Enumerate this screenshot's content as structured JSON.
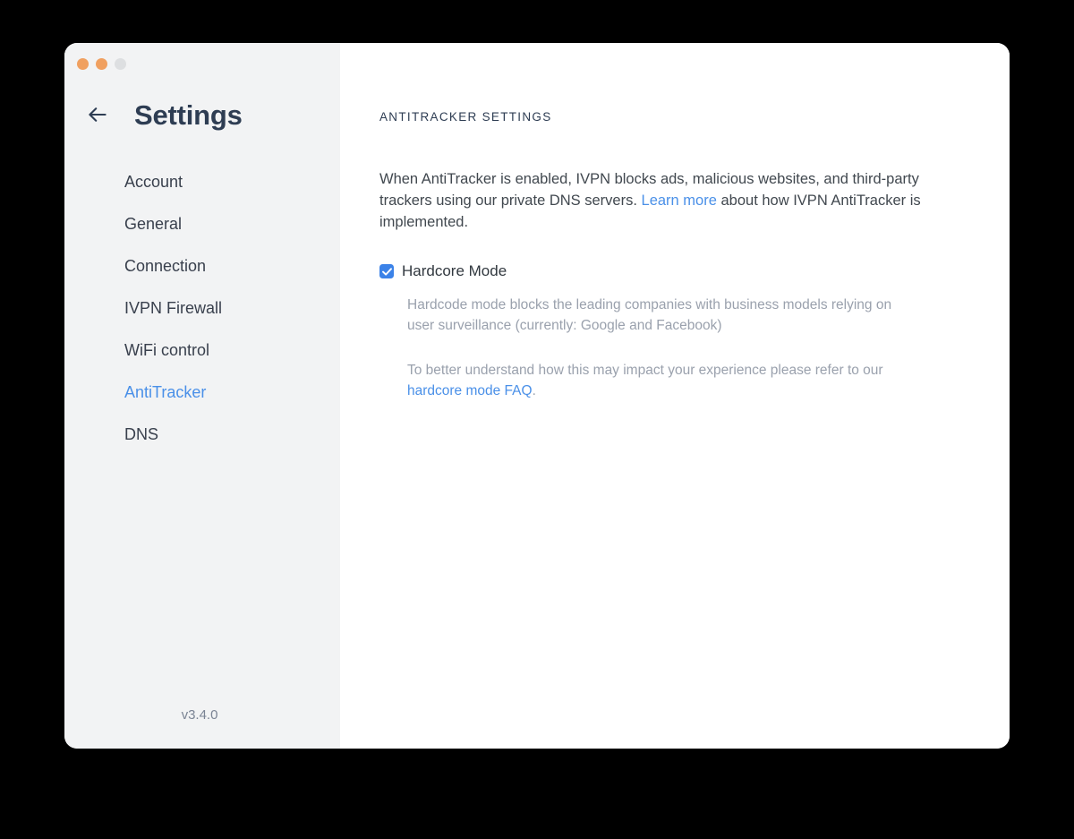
{
  "window": {
    "traffic_lights": [
      {
        "name": "close",
        "color": "#f0a060"
      },
      {
        "name": "minimize",
        "color": "#f0a060"
      },
      {
        "name": "zoom",
        "color": "#dddfe1"
      }
    ]
  },
  "sidebar": {
    "back_icon": "arrow-left-icon",
    "title": "Settings",
    "items": [
      {
        "label": "Account",
        "active": false
      },
      {
        "label": "General",
        "active": false
      },
      {
        "label": "Connection",
        "active": false
      },
      {
        "label": "IVPN Firewall",
        "active": false
      },
      {
        "label": "WiFi control",
        "active": false
      },
      {
        "label": "AntiTracker",
        "active": true
      },
      {
        "label": "DNS",
        "active": false
      }
    ],
    "version": "v3.4.0"
  },
  "content": {
    "section_title": "ANTITRACKER SETTINGS",
    "intro": {
      "part1": "When AntiTracker is enabled, IVPN blocks ads, malicious websites, and third-party trackers using our private DNS servers. ",
      "link": "Learn more",
      "part2": " about how IVPN AntiTracker is implemented."
    },
    "hardcore": {
      "label": "Hardcore Mode",
      "checked": true,
      "checkbox_icon": "check-icon",
      "note1": "Hardcode mode blocks the leading companies with business models relying on user surveillance (currently: Google and Facebook)",
      "note2_part1": "To better understand how this may impact your experience please refer to our ",
      "note2_link": "hardcore mode FAQ",
      "note2_part2": "."
    }
  },
  "colors": {
    "accent": "#4a90e8",
    "checkbox": "#3b82e8",
    "title": "#2e3d53",
    "sidebar_bg": "#f2f3f4",
    "content_bg": "#ffffff",
    "muted_text": "#9aa1ad",
    "desktop_bg": "#000000"
  }
}
